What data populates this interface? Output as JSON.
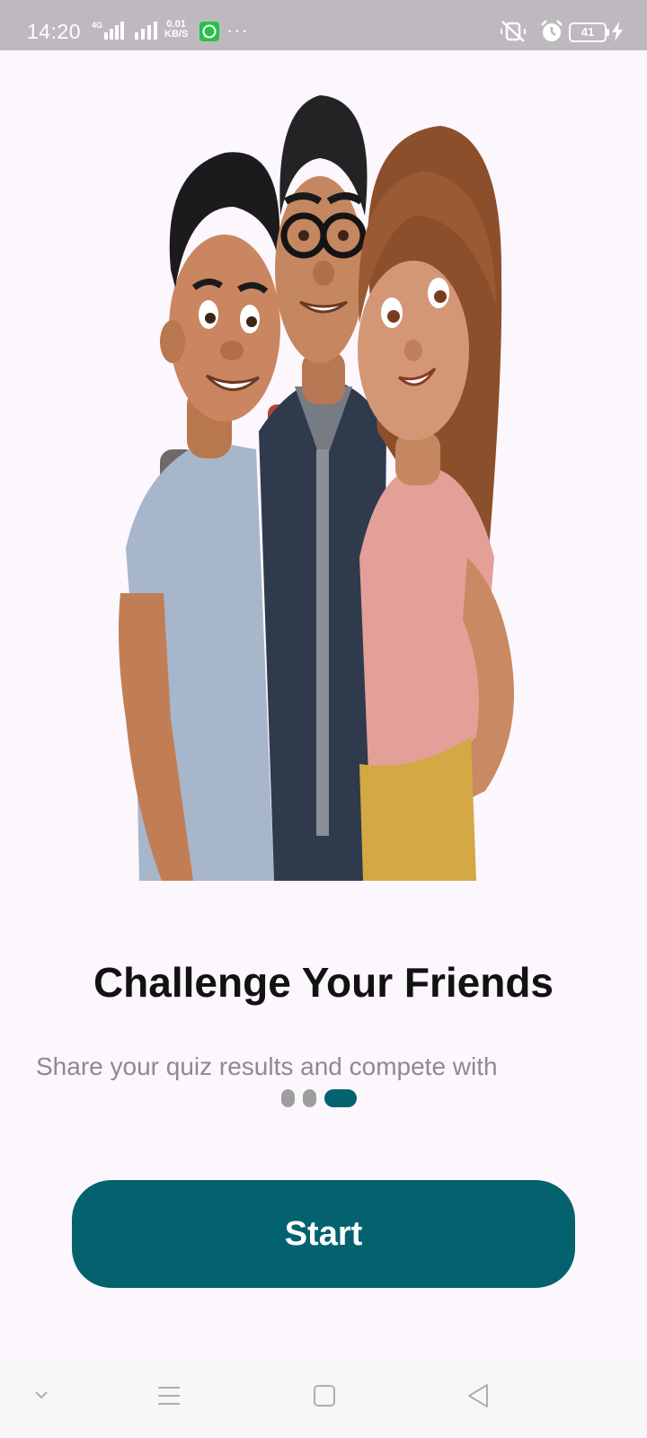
{
  "status_bar": {
    "time": "14:20",
    "network_type": "4G",
    "speed_value": "0.01",
    "speed_unit": "KB/S",
    "more_indicator": "···",
    "battery_level": "41",
    "icons": [
      "signal-icon",
      "whatsapp-icon",
      "mute-icon",
      "alarm-icon",
      "battery-icon",
      "charging-icon"
    ]
  },
  "onboarding": {
    "title": "Challenge Your Friends",
    "subtitle": "Share your quiz results and compete with",
    "page_count": 3,
    "active_page": 3
  },
  "actions": {
    "start_label": "Start"
  },
  "nav_bar": {
    "icons": [
      "chevron-down-icon",
      "menu-icon",
      "home-icon",
      "back-icon"
    ]
  },
  "colors": {
    "accent": "#04626f",
    "background": "#fcf6fd",
    "status_bar": "#bdb9bf",
    "title_text": "#121212",
    "subtitle_text": "#8d8a90",
    "inactive_dot": "#9d9d9d"
  }
}
